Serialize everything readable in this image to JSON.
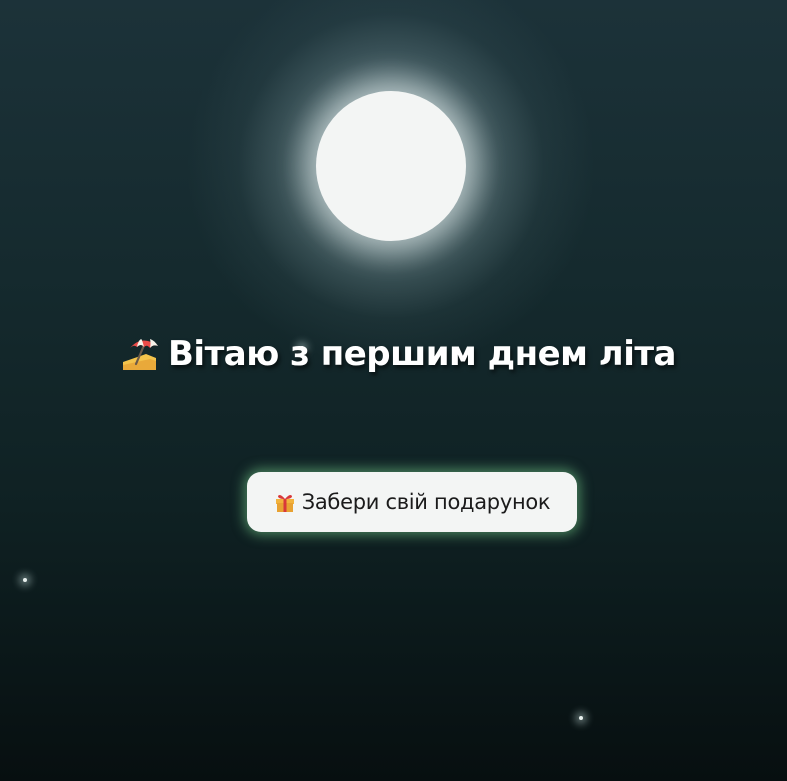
{
  "greeting": {
    "icon": "beach-umbrella-icon",
    "text": "Вітаю з першим днем літа"
  },
  "gift_button": {
    "icon": "gift-icon",
    "label": "Забери свій подарунок"
  },
  "colors": {
    "background_top": "#1c3239",
    "background_bottom": "#070f10",
    "moon": "#f3f5f4",
    "button_glow": "#78d28c",
    "heading_text": "#ffffff",
    "button_text": "#1b1b1b"
  }
}
